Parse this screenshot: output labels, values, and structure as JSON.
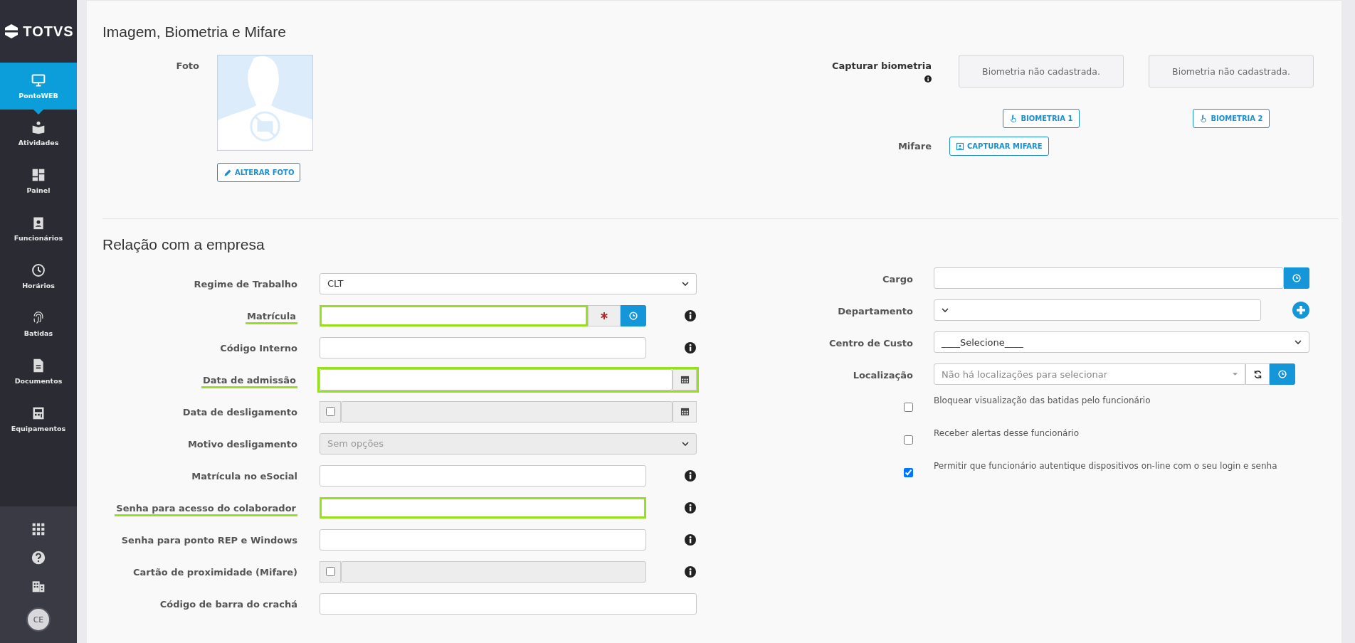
{
  "sidebar": {
    "logo": "TOTVS",
    "items": [
      {
        "label": "PontoWEB",
        "selected": true
      },
      {
        "label": "Atividades",
        "selected": false
      },
      {
        "label": "Painel",
        "selected": false
      },
      {
        "label": "Funcionários",
        "selected": false
      },
      {
        "label": "Horários",
        "selected": false
      },
      {
        "label": "Batidas",
        "selected": false
      },
      {
        "label": "Documentos",
        "selected": false
      },
      {
        "label": "Equipamentos",
        "selected": false
      }
    ],
    "avatar": "CE"
  },
  "media_section": {
    "title": "Imagem, Biometria e Mifare",
    "photo": {
      "label": "Foto",
      "button": "ALTERAR FOTO"
    },
    "biometrics": {
      "label": "Capturar biometria",
      "slots": [
        {
          "status": "Biometria não cadastrada.",
          "button": "BIOMETRIA 1"
        },
        {
          "status": "Biometria não cadastrada.",
          "button": "BIOMETRIA 2"
        }
      ]
    },
    "mifare": {
      "label": "Mifare",
      "button": "CAPTURAR MIFARE"
    }
  },
  "company_section": {
    "title": "Relação com a empresa",
    "left_fields": [
      {
        "label": "Regime de Trabalho",
        "kind": "select",
        "value": "CLT",
        "disabled": false,
        "highlighted": false,
        "info": false
      },
      {
        "label": "Matrícula",
        "kind": "required-lookup",
        "highlighted": true,
        "info": true
      },
      {
        "label": "Código Interno",
        "kind": "input",
        "highlighted": false,
        "info": true
      },
      {
        "label": "Data de admissão",
        "kind": "date",
        "highlighted": true,
        "info": false
      },
      {
        "label": "Data de desligamento",
        "kind": "date-toggle",
        "checked": false,
        "highlighted": false,
        "info": false
      },
      {
        "label": "Motivo desligamento",
        "kind": "select",
        "placeholder": "Sem opções",
        "disabled": true,
        "highlighted": false,
        "info": false
      },
      {
        "label": "Matrícula no eSocial",
        "kind": "input",
        "highlighted": false,
        "info": true
      },
      {
        "label": "Senha para acesso do colaborador",
        "kind": "input",
        "highlighted": true,
        "info": true
      },
      {
        "label": "Senha para ponto REP e Windows",
        "kind": "input",
        "highlighted": false,
        "info": true
      },
      {
        "label": "Cartão de proximidade (Mifare)",
        "kind": "toggle-input",
        "checked": false,
        "highlighted": false,
        "info": true
      },
      {
        "label": "Código de barra do crachá",
        "kind": "input",
        "highlighted": false,
        "info": false
      }
    ],
    "right_fields": [
      {
        "label": "Cargo",
        "kind": "lookup"
      },
      {
        "label": "Departamento",
        "kind": "select-add"
      },
      {
        "label": "Centro de Custo",
        "kind": "select",
        "value": "____Selecione____"
      },
      {
        "label": "Localização",
        "kind": "location",
        "placeholder": "Não há localizações para selecionar"
      }
    ],
    "options": [
      {
        "label": "Bloquear visualização das batidas pelo funcionário",
        "checked": false
      },
      {
        "label": "Receber alertas desse funcionário",
        "checked": false
      },
      {
        "label": "Permitir que funcionário autentique dispositivos on-line com o seu login e senha",
        "checked": true
      }
    ]
  }
}
